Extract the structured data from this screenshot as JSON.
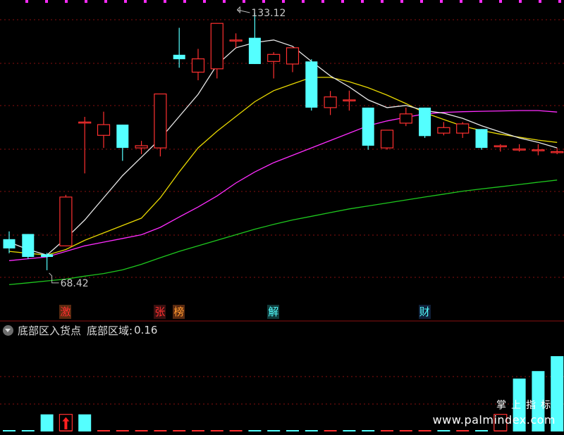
{
  "colors": {
    "up": "#ff3030",
    "down": "#54ffff",
    "ma_white": "#e8e8e8",
    "ma_yellow": "#e8d800",
    "ma_magenta": "#ff2cff",
    "ma_green": "#1ec81e",
    "grid": "#8a1010",
    "text": "#c8c8c8"
  },
  "price_panel": {
    "y_range": [
      60,
      140
    ],
    "high_label": "133.12",
    "low_label": "68.42",
    "candles": [
      {
        "o": 76.8,
        "c": 74.3,
        "h": 78.9,
        "l": 73.0
      },
      {
        "o": 78.2,
        "c": 72.0,
        "h": 78.2,
        "l": 71.5
      },
      {
        "o": 72.7,
        "c": 72.0,
        "h": 73.1,
        "l": 68.4
      },
      {
        "o": 75.0,
        "c": 88.2,
        "h": 88.8,
        "l": 74.9
      },
      {
        "o": 108.5,
        "c": 108.5,
        "h": 109.9,
        "l": 94.6
      },
      {
        "o": 104.9,
        "c": 107.8,
        "h": 111.3,
        "l": 101.5
      },
      {
        "o": 107.8,
        "c": 101.5,
        "h": 107.8,
        "l": 98.0
      },
      {
        "o": 101.5,
        "c": 102.1,
        "h": 103.4,
        "l": 99.8
      },
      {
        "o": 101.5,
        "c": 116.1,
        "h": 116.1,
        "l": 99.2
      },
      {
        "o": 126.7,
        "c": 125.5,
        "h": 134.0,
        "l": 123.2
      },
      {
        "o": 122.0,
        "c": 125.6,
        "h": 128.3,
        "l": 119.8
      },
      {
        "o": 122.9,
        "c": 135.2,
        "h": 135.2,
        "l": 120.3
      },
      {
        "o": 130.7,
        "c": 130.7,
        "h": 132.5,
        "l": 128.6
      },
      {
        "o": 131.3,
        "c": 124.2,
        "h": 138.1,
        "l": 124.2
      },
      {
        "o": 124.9,
        "c": 126.8,
        "h": 127.4,
        "l": 120.3
      },
      {
        "o": 124.2,
        "c": 128.6,
        "h": 128.6,
        "l": 122.0
      },
      {
        "o": 124.9,
        "c": 112.4,
        "h": 125.5,
        "l": 111.6
      },
      {
        "o": 112.4,
        "c": 115.3,
        "h": 116.9,
        "l": 110.4
      },
      {
        "o": 114.5,
        "c": 114.5,
        "h": 117.0,
        "l": 111.6
      },
      {
        "o": 112.4,
        "c": 102.1,
        "h": 112.4,
        "l": 101.0
      },
      {
        "o": 101.5,
        "c": 106.3,
        "h": 106.3,
        "l": 101.0
      },
      {
        "o": 108.2,
        "c": 110.7,
        "h": 112.4,
        "l": 107.4
      },
      {
        "o": 112.4,
        "c": 104.7,
        "h": 112.4,
        "l": 104.2
      },
      {
        "o": 105.5,
        "c": 107.0,
        "h": 108.5,
        "l": 104.9
      },
      {
        "o": 105.5,
        "c": 108.0,
        "h": 108.5,
        "l": 104.2
      },
      {
        "o": 106.6,
        "c": 101.5,
        "h": 106.6,
        "l": 101.0
      },
      {
        "o": 101.8,
        "c": 102.1,
        "h": 102.5,
        "l": 100.5
      },
      {
        "o": 101.0,
        "c": 101.2,
        "h": 102.5,
        "l": 100.5
      },
      {
        "o": 101.0,
        "c": 101.0,
        "h": 102.5,
        "l": 99.5
      },
      {
        "o": 100.5,
        "c": 100.5,
        "h": 101.5,
        "l": 99.8
      }
    ],
    "ma_white": [
      76.0,
      74.0,
      72.5,
      77.0,
      82.0,
      88.0,
      94.0,
      99.0,
      104.0,
      110.0,
      116.0,
      124.0,
      128.6,
      130.0,
      130.7,
      129.0,
      124.9,
      121.0,
      118.0,
      114.5,
      112.4,
      113.0,
      111.6,
      110.9,
      109.5,
      107.5,
      105.8,
      104.2,
      103.0,
      101.5
    ],
    "ma_yellow": [
      73.5,
      73.0,
      72.5,
      74.0,
      76.5,
      78.5,
      80.5,
      82.5,
      88.0,
      95.0,
      101.5,
      106.0,
      110.0,
      114.0,
      117.0,
      118.8,
      120.6,
      120.6,
      119.4,
      117.8,
      115.8,
      113.5,
      111.0,
      109.2,
      107.4,
      106.2,
      105.2,
      104.4,
      103.6,
      103.0
    ],
    "ma_magenta": [
      71.0,
      71.5,
      72.0,
      73.5,
      75.0,
      76.0,
      77.0,
      78.0,
      80.0,
      82.8,
      85.5,
      88.5,
      92.0,
      95.0,
      97.5,
      99.5,
      101.5,
      103.5,
      105.5,
      107.5,
      108.8,
      109.8,
      110.7,
      111.1,
      111.3,
      111.4,
      111.5,
      111.6,
      111.6,
      111.2
    ],
    "ma_green": [
      64.5,
      65.0,
      65.5,
      66.0,
      66.8,
      67.5,
      68.5,
      70.0,
      71.8,
      73.5,
      75.0,
      76.5,
      78.0,
      79.5,
      80.8,
      82.0,
      83.0,
      84.0,
      85.0,
      85.8,
      86.6,
      87.4,
      88.2,
      89.0,
      89.8,
      90.4,
      91.0,
      91.6,
      92.2,
      92.8
    ]
  },
  "markers": [
    {
      "text": "激",
      "index": 3,
      "color": "#ff3030",
      "bg": "#5a2a10"
    },
    {
      "text": "张",
      "index": 8,
      "color": "#ff3030",
      "bg": "#3a1010"
    },
    {
      "text": "榜",
      "index": 9,
      "color": "#ff9a30",
      "bg": "#5a2a10"
    },
    {
      "text": "解",
      "index": 14,
      "color": "#54ffff",
      "bg": "#103a3a"
    },
    {
      "text": "财",
      "index": 22,
      "color": "#54ffff",
      "bg": "#10203a"
    }
  ],
  "indicator_panel": {
    "name": "底部区入货点",
    "series_label": "底部区域:",
    "value": "0.16",
    "y_range": [
      0,
      1
    ],
    "bars": [
      0,
      0,
      0.22,
      0.22,
      0.22,
      0,
      0,
      0,
      0,
      0,
      0,
      0,
      0,
      0,
      0,
      0,
      0,
      0,
      0,
      0,
      0,
      0,
      0,
      0,
      0,
      0,
      0.22,
      0.7,
      0.8,
      1.0
    ],
    "bar_colors": [
      "#54ffff",
      "#54ffff",
      "#54ffff",
      "#ff3030",
      "#54ffff",
      "#ff3030",
      "#ff3030",
      "#ff3030",
      "#ff3030",
      "#ff3030",
      "#ff3030",
      "#ff3030",
      "#ff3030",
      "#54ffff",
      "#54ffff",
      "#54ffff",
      "#54ffff",
      "#ff3030",
      "#54ffff",
      "#54ffff",
      "#ff3030",
      "#ff3030",
      "#ff3030",
      "#54ffff",
      "#ff3030",
      "#54ffff",
      "#ff3030",
      "#54ffff",
      "#54ffff",
      "#54ffff"
    ]
  },
  "watermark": {
    "line1": "掌上指标",
    "line2": "www.palmindex.com"
  }
}
